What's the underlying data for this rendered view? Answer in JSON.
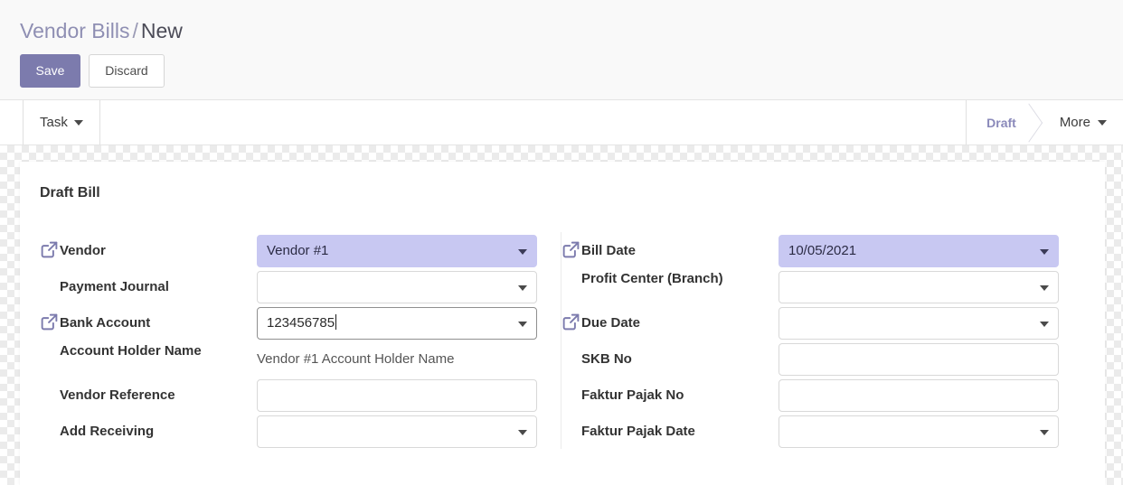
{
  "breadcrumb": {
    "parent": "Vendor Bills",
    "separator": "/",
    "current": "New"
  },
  "actions": {
    "save_label": "Save",
    "discard_label": "Discard"
  },
  "statusbar": {
    "left_button_label": "Task",
    "stage_label": "Draft",
    "more_label": "More",
    "stage_color": "#8a89ba"
  },
  "sheet": {
    "title": "Draft Bill",
    "left_fields": [
      {
        "label": "Vendor",
        "value": "Vendor #1",
        "type": "dropdown",
        "highlighted": true,
        "external_link": true,
        "name": "vendor"
      },
      {
        "label": "Payment Journal",
        "value": "",
        "type": "dropdown",
        "highlighted": false,
        "external_link": false,
        "name": "payment-journal"
      },
      {
        "label": "Bank Account",
        "value": "123456785",
        "type": "dropdown",
        "highlighted": false,
        "focused": true,
        "external_link": true,
        "name": "bank-account"
      },
      {
        "label": "Account Holder Name",
        "value": "Vendor #1 Account Holder Name",
        "type": "readonly",
        "highlighted": false,
        "external_link": false,
        "name": "account-holder-name"
      },
      {
        "label": "Vendor Reference",
        "value": "",
        "type": "text",
        "highlighted": false,
        "external_link": false,
        "name": "vendor-reference"
      },
      {
        "label": "Add Receiving",
        "value": "",
        "type": "dropdown",
        "highlighted": false,
        "external_link": false,
        "name": "add-receiving"
      }
    ],
    "right_fields": [
      {
        "label": "Bill Date",
        "value": "10/05/2021",
        "type": "dropdown",
        "highlighted": true,
        "external_link": true,
        "name": "bill-date"
      },
      {
        "label": "Profit Center (Branch)",
        "value": "",
        "type": "dropdown",
        "highlighted": false,
        "external_link": false,
        "name": "profit-center-branch"
      },
      {
        "label": "Due Date",
        "value": "",
        "type": "dropdown",
        "highlighted": false,
        "external_link": true,
        "name": "due-date"
      },
      {
        "label": "SKB No",
        "value": "",
        "type": "text",
        "highlighted": false,
        "external_link": false,
        "name": "skb-no"
      },
      {
        "label": "Faktur Pajak No",
        "value": "",
        "type": "text",
        "highlighted": false,
        "external_link": false,
        "name": "faktur-pajak-no"
      },
      {
        "label": "Faktur Pajak Date",
        "value": "",
        "type": "dropdown",
        "highlighted": false,
        "external_link": false,
        "name": "faktur-pajak-date"
      }
    ]
  },
  "colors": {
    "primary": "#7c7bad",
    "highlight": "#c8c8f2",
    "stage": "#8a89ba"
  }
}
